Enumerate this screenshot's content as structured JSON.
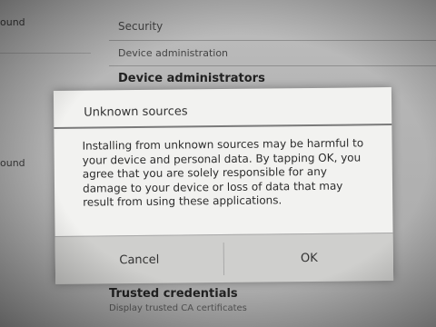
{
  "background": {
    "section_header": "Security",
    "device_admin_label": "Device administration",
    "device_admins_title": "Device administrators",
    "trusted_credentials_title": "Trusted credentials",
    "trusted_credentials_sub": "Display trusted CA certificates",
    "left_pane_top": "ound",
    "left_pane_mid": "ound"
  },
  "dialog": {
    "title": "Unknown sources",
    "message": "Installing from unknown sources may be harmful to your device and personal data. By tapping OK, you agree that you are solely responsible for any damage to your device or loss of data that may result from using these applications.",
    "cancel_label": "Cancel",
    "ok_label": "OK"
  }
}
